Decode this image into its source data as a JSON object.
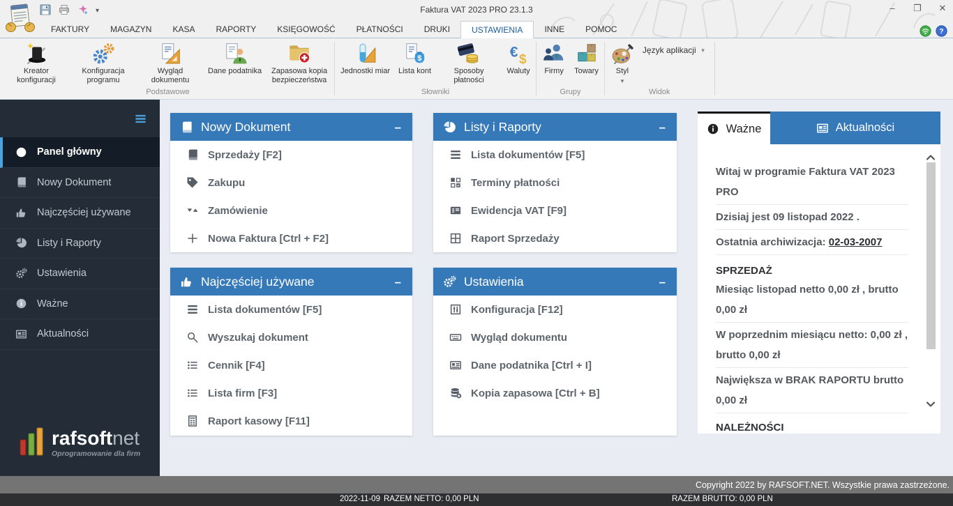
{
  "window": {
    "title": "Faktura VAT 2023 PRO 23.1.3",
    "controls": {
      "minimize": "–",
      "restore": "❐",
      "close": "✕"
    },
    "quick_access": {
      "save": "save-icon",
      "print": "print-icon",
      "appearance": "style-brush-icon",
      "more": "▾"
    }
  },
  "ribbon_tabs": {
    "items": [
      {
        "label": "FAKTURY"
      },
      {
        "label": "MAGAZYN"
      },
      {
        "label": "KASA"
      },
      {
        "label": "RAPORTY"
      },
      {
        "label": "KSIĘGOWOŚĆ"
      },
      {
        "label": "PŁATNOŚCI"
      },
      {
        "label": "DRUKI"
      },
      {
        "label": "USTAWIENIA",
        "active": true
      },
      {
        "label": "INNE"
      },
      {
        "label": "POMOC"
      }
    ]
  },
  "ribbon": {
    "groups": [
      {
        "label": "Podstawowe",
        "buttons": [
          {
            "label": "Kreator konfiguracji",
            "icon": "wizard-hat-icon"
          },
          {
            "label": "Konfiguracja programu",
            "icon": "color-gears-icon"
          },
          {
            "label": "Wygląd dokumentu",
            "icon": "document-ruler-icon"
          },
          {
            "label": "Dane podatnika",
            "icon": "taxpayer-icon"
          },
          {
            "label": "Zapasowa kopia bezpieczeństwa",
            "icon": "backup-folder-icon"
          }
        ]
      },
      {
        "label": "Słowniki",
        "buttons": [
          {
            "label": "Jednostki miar",
            "icon": "measuring-units-icon"
          },
          {
            "label": "Lista kont",
            "icon": "accounts-icon"
          },
          {
            "label": "Sposoby płatności",
            "icon": "payment-methods-icon"
          },
          {
            "label": "Waluty",
            "icon": "currency-icon"
          }
        ]
      },
      {
        "label": "Grupy",
        "buttons": [
          {
            "label": "Firmy",
            "icon": "companies-icon"
          },
          {
            "label": "Towary",
            "icon": "goods-icon"
          }
        ]
      },
      {
        "label": "Widok",
        "buttons": [
          {
            "label": "Styl",
            "icon": "style-palette-icon"
          },
          {
            "label": "Język aplikacji",
            "icon": "dropdown-arrow-icon"
          }
        ]
      }
    ]
  },
  "sidebar": {
    "items": [
      {
        "label": "Panel główny",
        "icon": "dashboard-icon",
        "active": true
      },
      {
        "label": "Nowy Dokument",
        "icon": "book-icon"
      },
      {
        "label": "Najczęściej używane",
        "icon": "thumbs-up-icon"
      },
      {
        "label": "Listy i Raporty",
        "icon": "pie-chart-icon"
      },
      {
        "label": "Ustawienia",
        "icon": "gears-icon"
      },
      {
        "label": "Ważne",
        "icon": "info-icon"
      },
      {
        "label": "Aktualności",
        "icon": "news-icon"
      }
    ],
    "logo": {
      "brand_bold": "rafsoft",
      "brand_light": "net",
      "tagline": "Oprogramowanie dla firm"
    }
  },
  "panels": [
    {
      "title": "Nowy Dokument",
      "icon": "book-icon",
      "collapse": "–",
      "items": [
        {
          "label": "Sprzedaży [F2]",
          "icon": "book-icon"
        },
        {
          "label": "Zakupu",
          "icon": "tag-icon"
        },
        {
          "label": "Zamówienie",
          "icon": "sort-triangles-icon"
        },
        {
          "label": "Nowa Faktura [Ctrl + F2]",
          "icon": "plus-icon"
        }
      ]
    },
    {
      "title": "Listy i Raporty",
      "icon": "pie-chart-icon",
      "collapse": "–",
      "items": [
        {
          "label": "Lista dokumentów [F5]",
          "icon": "list-rows-icon"
        },
        {
          "label": "Terminy płatności",
          "icon": "grid-check-icon"
        },
        {
          "label": "Ewidencja VAT [F9]",
          "icon": "vat-card-icon"
        },
        {
          "label": "Raport Sprzedaży",
          "icon": "table-icon"
        }
      ]
    },
    {
      "title": "Najczęściej używane",
      "icon": "thumbs-up-icon",
      "collapse": "–",
      "items": [
        {
          "label": "Lista dokumentów [F5]",
          "icon": "list-rows-icon"
        },
        {
          "label": "Wyszukaj dokument",
          "icon": "search-icon"
        },
        {
          "label": "Cennik [F4]",
          "icon": "list-dots-icon"
        },
        {
          "label": "Lista firm [F3]",
          "icon": "list-dots-icon"
        },
        {
          "label": "Raport kasowy [F11]",
          "icon": "calc-doc-icon"
        }
      ]
    },
    {
      "title": "Ustawienia",
      "icon": "gears-icon",
      "collapse": "–",
      "items": [
        {
          "label": "Konfiguracja [F12]",
          "icon": "sliders-icon"
        },
        {
          "label": "Wygląd dokumentu",
          "icon": "keyboard-icon"
        },
        {
          "label": "Dane podatnika [Ctrl + I]",
          "icon": "id-card-icon"
        },
        {
          "label": "Kopia zapasowa [Ctrl + B]",
          "icon": "database-backup-icon"
        }
      ]
    }
  ],
  "info_panel": {
    "tabs": [
      {
        "label": "Ważne",
        "icon": "info-icon",
        "active": true
      },
      {
        "label": "Aktualności",
        "icon": "news-icon",
        "active": false
      }
    ],
    "welcome": "Witaj w programie Faktura VAT 2023 PRO",
    "today": "Dzisiaj jest 09 listopad 2022 .",
    "archive_label": "Ostatnia archiwizacja:",
    "archive_date": "02-03-2007",
    "sales_heading": "SPRZEDAŻ",
    "sales_lines": [
      "Miesiąc listopad netto 0,00 zł , brutto 0,00 zł",
      "W poprzednim miesiącu netto: 0,00 zł , brutto 0,00 zł",
      "Największa w BRAK RAPORTU brutto 0,00 zł"
    ],
    "receivables_heading": "NALEŻNOŚCI"
  },
  "statusbar": {
    "copyright": "Copyright 2022 by RAFSOFT.NET. Wszystkie prawa zastrzeżone.",
    "date": "2022-11-09",
    "net_total": "RAZEM NETTO: 0,00 PLN",
    "gross_total": "RAZEM BRUTTO: 0,00 PLN"
  },
  "colors": {
    "accent_blue": "#3579b8",
    "sidebar_bg": "#232c37",
    "sidebar_active_bg": "#141d27",
    "sidebar_active_border": "#4aa3df",
    "status_gray": "#747474",
    "status_dark": "#2e2f31",
    "content_bg": "#e9edf3"
  }
}
